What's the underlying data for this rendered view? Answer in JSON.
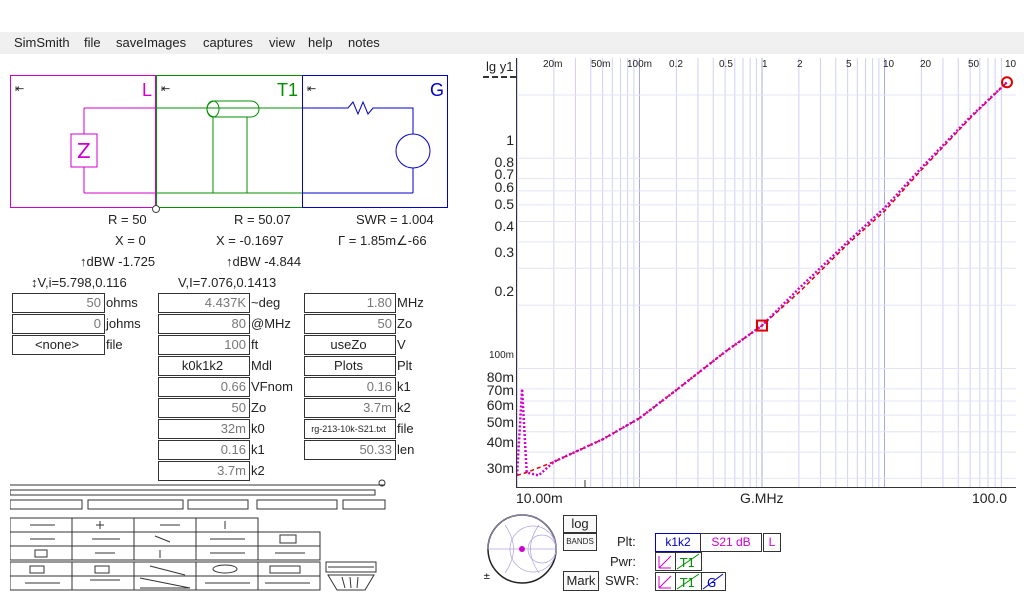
{
  "menu": [
    "SimSmith",
    "file",
    "saveImages",
    "captures",
    "view",
    "help",
    "notes"
  ],
  "circuit": {
    "load": {
      "label": "L",
      "pin": "⇤",
      "r": "R = 50",
      "x": "X = 0",
      "dbw": "↑dBW -1.725",
      "vi": "↕V,i=5.798,0.116"
    },
    "line": {
      "label": "T1",
      "pin": "⇤",
      "r": "R = 50.07",
      "x": "X = -0.1697",
      "dbw": "↑dBW -4.844",
      "vi": "V,I=7.076,0.1413"
    },
    "gen": {
      "label": "G",
      "pin": "⇤",
      "swr": "SWR = 1.004",
      "gamma": "Γ = 1.85m∠-66"
    }
  },
  "colors": {
    "load": "#d000d0",
    "line": "#009000",
    "gen": "#0000c8",
    "trace": "#e0007a",
    "marker": "#e00000"
  },
  "load_params": [
    {
      "value": "50",
      "unit": "ohms"
    },
    {
      "value": "0",
      "unit": "johms"
    },
    {
      "value": "<none>",
      "unit": "file"
    }
  ],
  "line_params": [
    {
      "value": "4.437K",
      "unit": "~deg"
    },
    {
      "value": "80",
      "unit": "@MHz"
    },
    {
      "value": "100",
      "unit": "ft"
    },
    {
      "value": "k0k1k2",
      "unit": "Mdl"
    },
    {
      "value": "0.66",
      "unit": "VFnom"
    },
    {
      "value": "50",
      "unit": "Zo"
    },
    {
      "value": "32m",
      "unit": "k0"
    },
    {
      "value": "0.16",
      "unit": "k1"
    },
    {
      "value": "3.7m",
      "unit": "k2"
    }
  ],
  "gen_params": [
    {
      "value": "1.80",
      "unit": "MHz"
    },
    {
      "value": "50",
      "unit": "Zo"
    },
    {
      "value": "useZo",
      "unit": "V"
    },
    {
      "value": "Plots",
      "unit": "Plt"
    },
    {
      "value": "0.16",
      "unit": "k1"
    },
    {
      "value": "3.7m",
      "unit": "k2"
    },
    {
      "value": "rg-213-10k-S21.txt",
      "unit": "file"
    },
    {
      "value": "50.33",
      "unit": "len"
    }
  ],
  "plot": {
    "y_axis_title": "lg y1",
    "top_ticks": [
      "20m",
      "50m",
      "100m",
      "0.2",
      "0.5",
      "1",
      "2",
      "5",
      "10",
      "20",
      "50",
      "10"
    ],
    "y_labels": [
      "1",
      "0.8",
      "0.7",
      "0.6",
      "0.5",
      "0.4",
      "0.3",
      "0.2",
      "100m",
      "80m",
      "70m",
      "60m",
      "50m",
      "40m",
      "30m"
    ],
    "x_start": "10.00m",
    "x_mid": "G.MHz",
    "x_end": "100.0"
  },
  "chart_data": {
    "type": "line",
    "xscale": "log",
    "yscale": "log",
    "xlabel": "G.MHz",
    "ylabel": "lg y1",
    "xlim": [
      0.01,
      100
    ],
    "ylim": [
      0.027,
      3
    ],
    "series": [
      {
        "values": [
          [
            0.01,
            0.031
          ],
          [
            0.012,
            0.032
          ],
          [
            0.02,
            0.036
          ],
          [
            0.05,
            0.046
          ],
          [
            0.1,
            0.058
          ],
          [
            0.2,
            0.079
          ],
          [
            0.5,
            0.12
          ],
          [
            1,
            0.16
          ],
          [
            2,
            0.23
          ],
          [
            5,
            0.39
          ],
          [
            10,
            0.56
          ],
          [
            20,
            0.88
          ],
          [
            50,
            1.55
          ],
          [
            100,
            2.3
          ]
        ]
      },
      {
        "values": [
          [
            0.01,
            0.031
          ],
          [
            0.011,
            0.08
          ],
          [
            0.012,
            0.032
          ],
          [
            0.015,
            0.031
          ],
          [
            0.02,
            0.036
          ],
          [
            0.05,
            0.046
          ],
          [
            0.1,
            0.058
          ],
          [
            0.2,
            0.079
          ],
          [
            0.5,
            0.12
          ],
          [
            1,
            0.16
          ],
          [
            2,
            0.24
          ],
          [
            5,
            0.4
          ],
          [
            10,
            0.58
          ],
          [
            20,
            0.9
          ],
          [
            50,
            1.57
          ],
          [
            100,
            2.3
          ]
        ]
      }
    ],
    "markers": [
      [
        1,
        0.16
      ],
      [
        100,
        2.3
      ]
    ]
  },
  "bottom": {
    "log_btn": "log",
    "bands_btn": "BANDS",
    "mark_btn": "Mark",
    "plt_label": "Plt:",
    "pwr_label": "Pwr:",
    "swr_label": "SWR:",
    "plt_items": [
      "k1k2",
      "S21 dB",
      "L"
    ]
  }
}
